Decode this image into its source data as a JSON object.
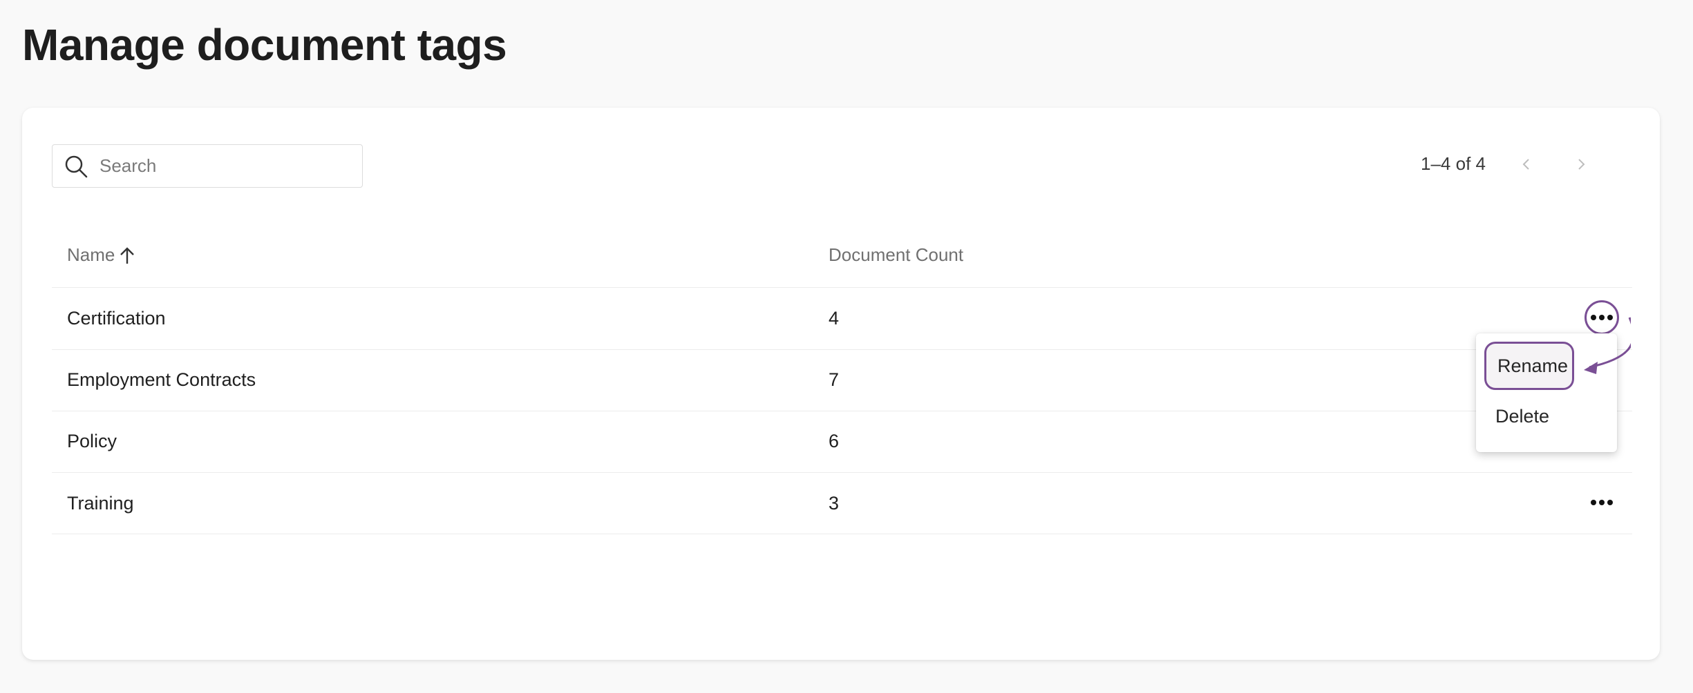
{
  "page": {
    "title": "Manage document tags"
  },
  "search": {
    "placeholder": "Search",
    "value": ""
  },
  "pagination": {
    "range": "1–4 of 4"
  },
  "table": {
    "columns": [
      "Name",
      "Document Count"
    ],
    "sort": {
      "column": "Name",
      "direction": "ascending"
    },
    "rows": [
      {
        "name": "Certification",
        "count": "4"
      },
      {
        "name": "Employment Contracts",
        "count": "7"
      },
      {
        "name": "Policy",
        "count": "6"
      },
      {
        "name": "Training",
        "count": "3"
      }
    ]
  },
  "row_menu": {
    "items": [
      "Rename",
      "Delete"
    ],
    "highlighted": "Rename"
  },
  "icons": {
    "search": "search-icon",
    "sort": "arrow-up-icon",
    "prev": "chevron-left-icon",
    "next": "chevron-right-icon",
    "more": "more-horizontal-icon"
  },
  "colors": {
    "annotation": "#7a4f95"
  }
}
